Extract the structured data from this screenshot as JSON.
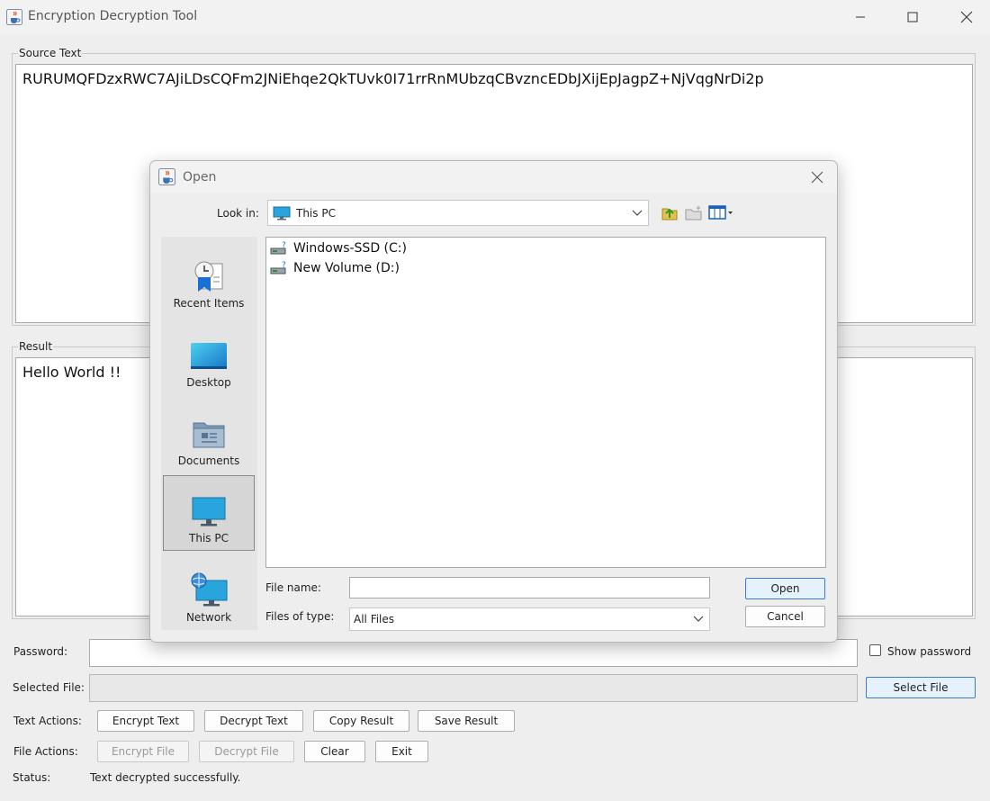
{
  "window": {
    "title": "Encryption Decryption Tool"
  },
  "source": {
    "legend": "Source Text",
    "value": "RURUMQFDzxRWC7AJiLDsCQFm2JNiEhqe2QkTUvk0I71rrRnMUbzqCBvzncEDbJXijEpJagpZ+NjVqgNrDi2p"
  },
  "result": {
    "legend": "Result",
    "value": "Hello World !!"
  },
  "password": {
    "label": "Password:",
    "value": "",
    "show_label": "Show password"
  },
  "selected_file": {
    "label": "Selected File:",
    "value": "",
    "button": "Select File"
  },
  "text_actions": {
    "label": "Text Actions:",
    "encrypt": "Encrypt Text",
    "decrypt": "Decrypt Text",
    "copy": "Copy Result",
    "save": "Save Result"
  },
  "file_actions": {
    "label": "File Actions:",
    "encrypt": "Encrypt File",
    "decrypt": "Decrypt File",
    "clear": "Clear",
    "exit": "Exit"
  },
  "status": {
    "label": "Status:",
    "value": "Text decrypted successfully."
  },
  "dialog": {
    "title": "Open",
    "look_in_label": "Look in:",
    "look_in_value": "This PC",
    "places": [
      {
        "label": "Recent Items",
        "icon": "recent-items-icon"
      },
      {
        "label": "Desktop",
        "icon": "desktop-icon"
      },
      {
        "label": "Documents",
        "icon": "documents-icon"
      },
      {
        "label": "This PC",
        "icon": "computer-icon",
        "selected": true
      },
      {
        "label": "Network",
        "icon": "network-icon"
      }
    ],
    "files": [
      {
        "name": "Windows-SSD (C:)",
        "icon": "drive-icon"
      },
      {
        "name": "New Volume (D:)",
        "icon": "drive-icon"
      }
    ],
    "file_name_label": "File name:",
    "file_name_value": "",
    "file_type_label": "Files of type:",
    "file_type_value": "All Files",
    "open_button": "Open",
    "cancel_button": "Cancel"
  },
  "colors": {
    "accent": "#3d7bc7",
    "selected_button_bg": "#e5f1fb",
    "window_bg": "#eeeeee"
  }
}
